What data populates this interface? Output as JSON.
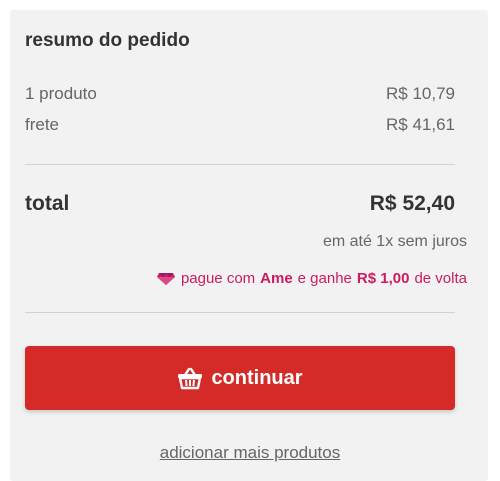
{
  "summary": {
    "title": "resumo do pedido",
    "items_label": "1 produto",
    "items_value": "R$ 10,79",
    "shipping_label": "frete",
    "shipping_value": "R$ 41,61",
    "total_label": "total",
    "total_value": "R$ 52,40",
    "installments": "em até 1x sem juros"
  },
  "ame_promo": {
    "text_prefix": "pague com",
    "brand": "Ame",
    "text_middle": "e ganhe",
    "cashback": "R$ 1,00",
    "text_suffix": "de volta",
    "icon": "ame-gem-icon",
    "color": "#cc1b64"
  },
  "actions": {
    "continue_label": "continuar",
    "continue_icon": "basket-icon",
    "continue_color": "#d52b28",
    "add_more_label": "adicionar mais produtos"
  }
}
